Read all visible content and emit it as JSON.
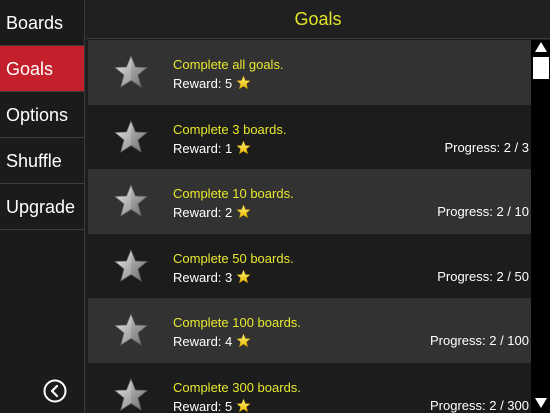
{
  "sidebar": {
    "items": [
      {
        "label": "Boards",
        "active": false
      },
      {
        "label": "Goals",
        "active": true
      },
      {
        "label": "Options",
        "active": false
      },
      {
        "label": "Shuffle",
        "active": false
      },
      {
        "label": "Upgrade",
        "active": false
      }
    ],
    "back_icon": "circle-chevron-left-icon"
  },
  "header": {
    "title": "Goals"
  },
  "goals": [
    {
      "title": "Complete all goals.",
      "reward": "Reward: 5",
      "progress": ""
    },
    {
      "title": "Complete 3 boards.",
      "reward": "Reward: 1",
      "progress": "Progress: 2 / 3"
    },
    {
      "title": "Complete 10 boards.",
      "reward": "Reward: 2",
      "progress": "Progress: 2 / 10"
    },
    {
      "title": "Complete 50 boards.",
      "reward": "Reward: 3",
      "progress": "Progress: 2 / 50"
    },
    {
      "title": "Complete 100 boards.",
      "reward": "Reward: 4",
      "progress": "Progress: 2 / 100"
    },
    {
      "title": "Complete 300 boards.",
      "reward": "Reward: 5",
      "progress": "Progress: 2 / 300"
    }
  ],
  "colors": {
    "accent_red": "#c4202c",
    "title_yellow": "#e8e82c",
    "star_gold": "#f5d020",
    "goal_star_silver": "#a8a8a8"
  },
  "icons": {
    "goal": "silver-star-icon",
    "reward": "gold-star-icon"
  }
}
